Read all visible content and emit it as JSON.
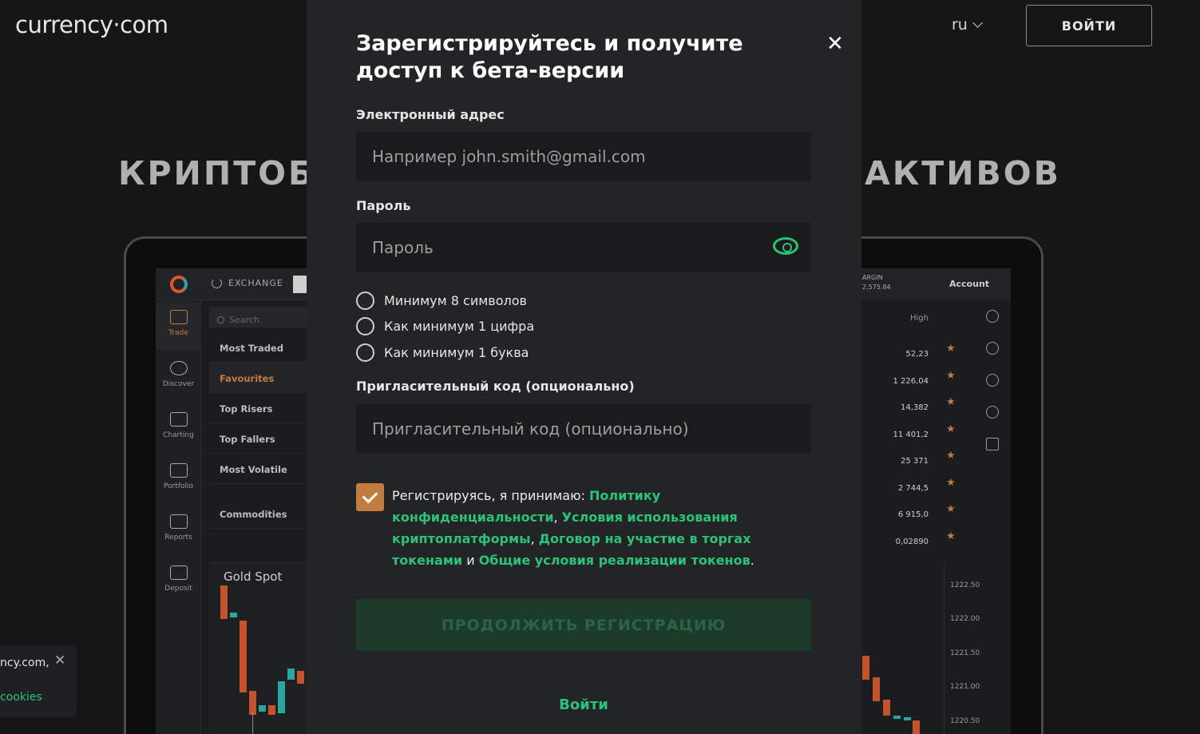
{
  "header": {
    "logo_text": "currency·com",
    "language": "ru",
    "login_label": "ВОЙТИ"
  },
  "hero": {
    "title_left": "КРИПТОБ",
    "title_right": "АКТИВОВ"
  },
  "app_preview": {
    "exchange_label": "EXCHANGE",
    "search_placeholder": "Search",
    "rail": [
      "Trade",
      "Discover",
      "Charting",
      "Portfolio",
      "Reports",
      "Deposit"
    ],
    "lists": [
      "Most Traded",
      "Favourites",
      "Top Risers",
      "Top Fallers",
      "Most Volatile",
      "Commodities"
    ],
    "chart_title": "Gold Spot",
    "margin_label": "ARGIN",
    "margin_value": "2,575.84",
    "account_label": "Account",
    "high_label": "High",
    "high_values": [
      "52,23",
      "1 226,04",
      "14,382",
      "11 401,2",
      "25 371",
      "2 744,5",
      "6 915,0",
      "0,02890"
    ],
    "price_scale": [
      "1222.50",
      "1222.00",
      "1221.50",
      "1221.00",
      "1220.50"
    ]
  },
  "cookie": {
    "text": "ncy.com,",
    "link": "cookies"
  },
  "modal": {
    "title": "Зарегистрируйтесь и получите доступ к бета-версии",
    "close_icon": "close-icon",
    "email_label": "Электронный адрес",
    "email_placeholder": "Например john.smith@gmail.com",
    "password_label": "Пароль",
    "password_placeholder": "Пароль",
    "requirements": [
      "Минимум 8 символов",
      "Как минимум 1 цифра",
      "Как минимум 1 буква"
    ],
    "invite_label": "Пригласительный код (опционально)",
    "invite_placeholder": "Пригласительный код (опционально)",
    "agree_prefix": "Регистрируясь, я принимаю: ",
    "link_privacy": "Политику конфиденциальности",
    "sep1": ", ",
    "link_terms": "Условия использования криптоплатформы",
    "sep2": ", ",
    "link_contract": "Договор на участие в торгах токенами",
    "sep3": " и ",
    "link_general": "Общие условия реализации токенов",
    "agree_suffix": ".",
    "continue_label": "ПРОДОЛЖИТЬ РЕГИСТРАЦИЮ",
    "login_link": "Войти"
  },
  "colors": {
    "accent_green": "#2bc37a",
    "accent_orange": "#c47b3e",
    "modal_bg": "#232426"
  }
}
